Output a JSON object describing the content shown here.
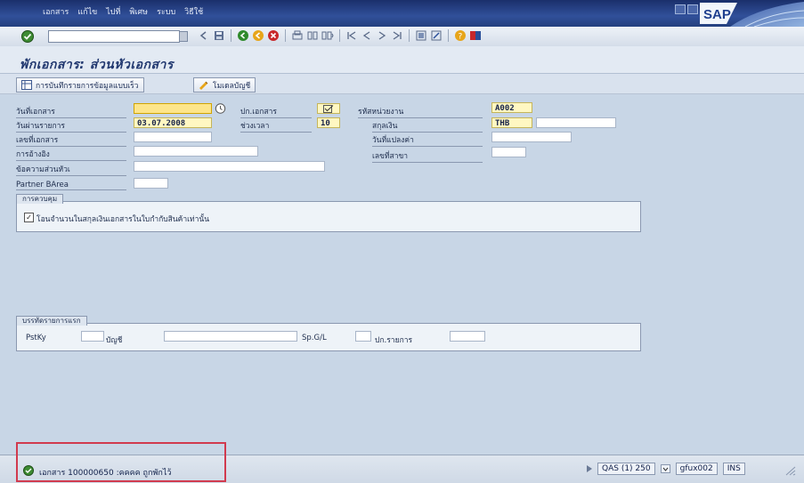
{
  "menu": {
    "items": [
      "เอกสาร",
      "แก้ไข",
      "ไปที่",
      "พิเศษ",
      "ระบบ",
      "วิธีใช้"
    ]
  },
  "brand": {
    "logo_text": "SAP"
  },
  "toolbar": {
    "command_value": ""
  },
  "screen": {
    "title": "พักเอกสาร: ส่วนหัวเอกสาร"
  },
  "app_toolbar": {
    "fast_entry_label": "การบันทึกรายการข้อมูลแบบเร็ว",
    "model_account_label": "โมเดลบัญชี"
  },
  "header_form": {
    "doc_date_label": "วันที่เอกสาร",
    "doc_date_value": "",
    "posting_date_label": "วันผ่านรายการ",
    "posting_date_value": "03.07.2008",
    "doc_number_label": "เลขที่เอกสาร",
    "doc_number_value": "",
    "reference_label": "การอ้างอิง",
    "reference_value": "",
    "header_text_label": "ข้อความส่วนหัวเ",
    "header_text_value": "",
    "partner_barea_label": "Partner BArea",
    "partner_barea_value": "",
    "doc_type_label": "ปก.เอกสาร",
    "doc_type_value": "",
    "period_label": "ช่วงเวลา",
    "period_value": "10",
    "company_code_label": "รหัสหน่วยงาน",
    "company_code_value": "A002",
    "currency_label": "สกุลเงิน",
    "currency_value": "THB",
    "currency_extra_value": "",
    "translation_date_label": "วันที่แปลงค่า",
    "translation_date_value": "",
    "branch_label": "เลขที่สาขา",
    "branch_value": ""
  },
  "control_group": {
    "title": "การควบคุม",
    "checkbox_label": "โอนจำนวนในสกุลเงินเอกสารในใบกำกับสินค้าเท่านั้น",
    "checkbox_checked": true
  },
  "first_line_group": {
    "title": "บรรทัดรายการแรก",
    "pstky_label": "PstKy",
    "pstky_value": "",
    "account_label": "บัญชี",
    "account_value": "",
    "spgl_label": "Sp.G/L",
    "spgl_value": "",
    "trans_type_label": "ปก.รายการ",
    "trans_type_value": ""
  },
  "status_bar": {
    "message": "เอกสาร 100000650 :คคคค ถูกพักไว้",
    "system": "QAS (1) 250",
    "server": "gfux002",
    "mode": "INS"
  },
  "colors": {
    "title_bar": "#24407f",
    "highlight_box": "#d13a4e",
    "required_field": "#fde58a"
  }
}
